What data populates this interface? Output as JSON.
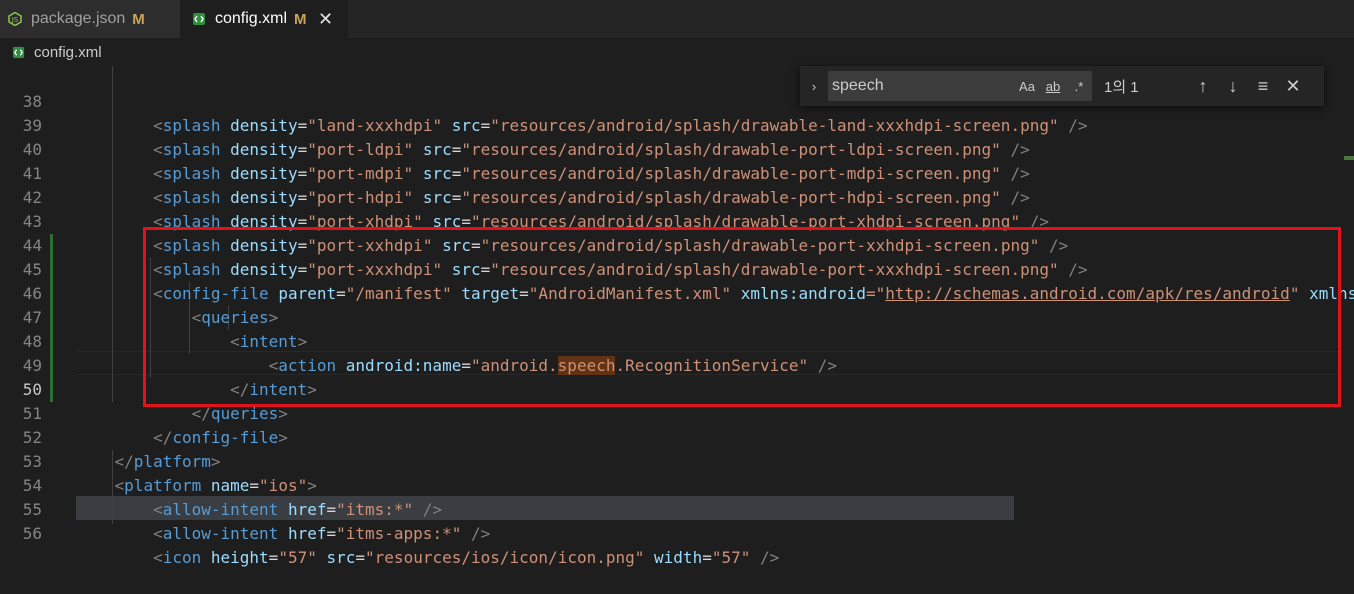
{
  "tabs": [
    {
      "name": "package.json",
      "modified": "M"
    },
    {
      "name": "config.xml",
      "modified": "M",
      "close": "✕"
    }
  ],
  "breadcrumb": {
    "file": "config.xml"
  },
  "find": {
    "query": "speech",
    "match_case": "Aa",
    "whole_word": "ab",
    "regex": ".*",
    "count": "1의 1",
    "prev": "↑",
    "next": "↓",
    "selection": "≡",
    "close": "✕",
    "toggle": "›"
  },
  "lines": [
    {
      "n": "38",
      "t": [
        "<",
        "splash",
        " ",
        "density",
        "=",
        "\"land-xxxhdpi\"",
        " ",
        "src",
        "=",
        "\"resources/android/splash/drawable-land-xxxhdpi-screen.png\"",
        " />"
      ]
    },
    {
      "n": "39",
      "t": [
        "<",
        "splash",
        " ",
        "density",
        "=",
        "\"port-ldpi\"",
        " ",
        "src",
        "=",
        "\"resources/android/splash/drawable-port-ldpi-screen.png\"",
        " />"
      ]
    },
    {
      "n": "40",
      "t": [
        "<",
        "splash",
        " ",
        "density",
        "=",
        "\"port-mdpi\"",
        " ",
        "src",
        "=",
        "\"resources/android/splash/drawable-port-mdpi-screen.png\"",
        " />"
      ]
    },
    {
      "n": "41",
      "t": [
        "<",
        "splash",
        " ",
        "density",
        "=",
        "\"port-hdpi\"",
        " ",
        "src",
        "=",
        "\"resources/android/splash/drawable-port-hdpi-screen.png\"",
        " />"
      ]
    },
    {
      "n": "42",
      "t": [
        "<",
        "splash",
        " ",
        "density",
        "=",
        "\"port-xhdpi\"",
        " ",
        "src",
        "=",
        "\"resources/android/splash/drawable-port-xhdpi-screen.png\"",
        " />"
      ]
    },
    {
      "n": "43",
      "t": [
        "<",
        "splash",
        " ",
        "density",
        "=",
        "\"port-xxhdpi\"",
        " ",
        "src",
        "=",
        "\"resources/android/splash/drawable-port-xxhdpi-screen.png\"",
        " />"
      ]
    },
    {
      "n": "44",
      "t": [
        "<",
        "splash",
        " ",
        "density",
        "=",
        "\"port-xxxhdpi\"",
        " ",
        "src",
        "=",
        "\"resources/android/splash/drawable-port-xxxhdpi-screen.png\"",
        " />"
      ]
    },
    {
      "n": "45",
      "t": [
        "<",
        "config-file",
        " ",
        "parent",
        "=",
        "\"/manifest\"",
        " ",
        "target",
        "=",
        "\"AndroidManifest.xml\"",
        " ",
        "xmlns:android",
        "=\"",
        "http://schemas.android.com/apk/res/android",
        "\"",
        " ",
        "xmlns:tools"
      ]
    },
    {
      "n": "46",
      "t": [
        "<",
        "queries",
        ">"
      ]
    },
    {
      "n": "47",
      "t": [
        "<",
        "intent",
        ">"
      ]
    },
    {
      "n": "48",
      "t": [
        "<",
        "action",
        " ",
        "android:name",
        "=",
        "\"android.",
        "speech",
        ".RecognitionService\"",
        " />"
      ]
    },
    {
      "n": "49",
      "t": [
        "</",
        "intent",
        ">"
      ]
    },
    {
      "n": "50",
      "t": [
        "</",
        "queries",
        ">"
      ]
    },
    {
      "n": "51",
      "t": [
        "</",
        "config-file",
        ">"
      ]
    },
    {
      "n": "52",
      "t": [
        "</",
        "platform",
        ">"
      ]
    },
    {
      "n": "53",
      "t": [
        "<",
        "platform",
        " ",
        "name",
        "=",
        "\"ios\"",
        ">"
      ]
    },
    {
      "n": "54",
      "t": [
        "<",
        "allow-intent",
        " ",
        "href",
        "=",
        "\"itms:*\"",
        " />"
      ]
    },
    {
      "n": "55",
      "t": [
        "<",
        "allow-intent",
        " ",
        "href",
        "=",
        "\"itms-apps:*\"",
        " />"
      ]
    },
    {
      "n": "56",
      "t": [
        "<",
        "icon",
        " ",
        "height",
        "=",
        "\"57\"",
        " ",
        "src",
        "=",
        "\"resources/ios/icon/icon.png\"",
        " ",
        "width",
        "=",
        "\"57\"",
        " />"
      ]
    }
  ]
}
